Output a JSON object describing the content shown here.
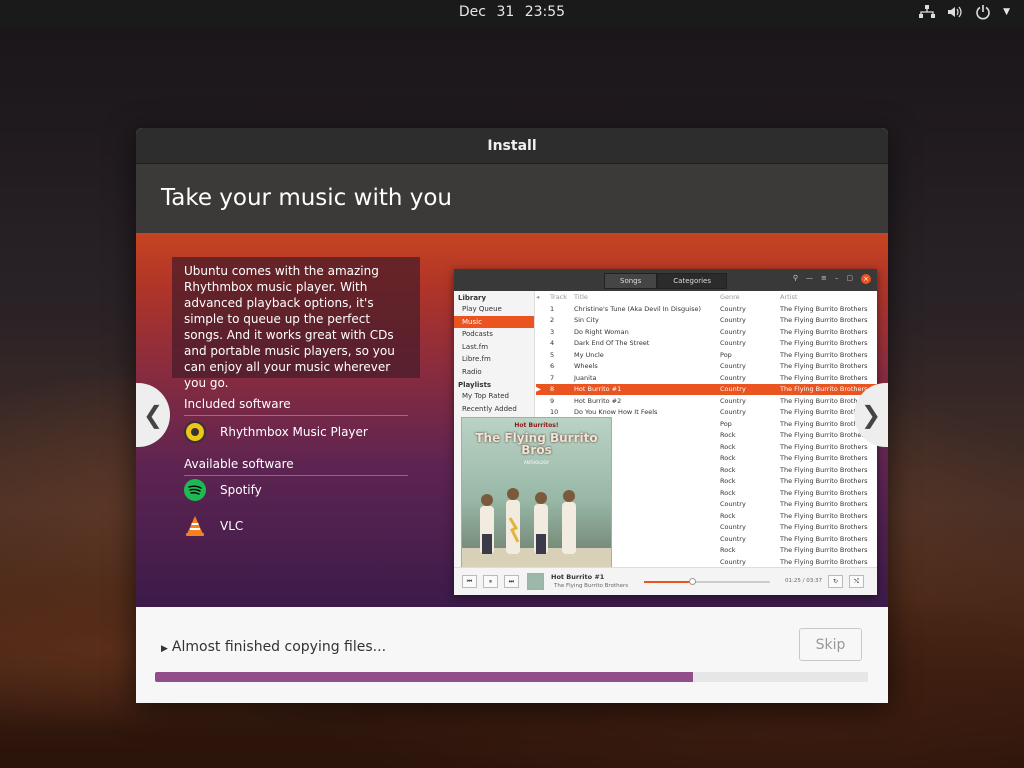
{
  "topbar": {
    "date": "Dec 31",
    "time": "23:55",
    "network_icon": "network-icon",
    "volume_icon": "volume-icon",
    "power_icon": "power-icon",
    "menu_icon": "caret-down-icon"
  },
  "window": {
    "title": "Install"
  },
  "slide": {
    "heading": "Take your music with you",
    "description": "Ubuntu comes with the amazing Rhythmbox music player. With advanced playback options, it's simple to queue up the perfect songs. And it works great with CDs and portable music players, so you can enjoy all your music wherever you go.",
    "included_label": "Included software",
    "included": [
      {
        "name": "Rhythmbox Music Player",
        "icon": "rhythmbox-icon"
      }
    ],
    "available_label": "Available software",
    "available": [
      {
        "name": "Spotify",
        "icon": "spotify-icon",
        "color": "#1db954"
      },
      {
        "name": "VLC",
        "icon": "vlc-icon",
        "color": "#f58220"
      }
    ],
    "prev_arrow": "❮",
    "next_arrow": "❯"
  },
  "rhythmbox": {
    "tabs": [
      "Songs",
      "Categories"
    ],
    "sidebar": {
      "library_label": "Library",
      "library": [
        "Play Queue",
        "Music",
        "Podcasts",
        "Last.fm",
        "Libre.fm",
        "Radio"
      ],
      "playlists_label": "Playlists",
      "playlists": [
        "My Top Rated",
        "Recently Added"
      ]
    },
    "columns": [
      "Track",
      "Title",
      "Genre",
      "Artist"
    ],
    "rows": [
      {
        "track": "1",
        "title": "Christine's Tune (Aka Devil In Disguise)",
        "genre": "Country",
        "artist": "The Flying Burrito Brothers"
      },
      {
        "track": "2",
        "title": "Sin City",
        "genre": "Country",
        "artist": "The Flying Burrito Brothers"
      },
      {
        "track": "3",
        "title": "Do Right Woman",
        "genre": "Country",
        "artist": "The Flying Burrito Brothers"
      },
      {
        "track": "4",
        "title": "Dark End Of The Street",
        "genre": "Country",
        "artist": "The Flying Burrito Brothers"
      },
      {
        "track": "5",
        "title": "My Uncle",
        "genre": "Pop",
        "artist": "The Flying Burrito Brothers"
      },
      {
        "track": "6",
        "title": "Wheels",
        "genre": "Country",
        "artist": "The Flying Burrito Brothers"
      },
      {
        "track": "7",
        "title": "Juanita",
        "genre": "Country",
        "artist": "The Flying Burrito Brothers"
      },
      {
        "track": "8",
        "title": "Hot Burrito #1",
        "genre": "Country",
        "artist": "The Flying Burrito Brothers"
      },
      {
        "track": "9",
        "title": "Hot Burrito #2",
        "genre": "Country",
        "artist": "The Flying Burrito Brothers"
      },
      {
        "track": "10",
        "title": "Do You Know How It Feels",
        "genre": "Country",
        "artist": "The Flying Burrito Brothers"
      },
      {
        "track": "",
        "title": "",
        "genre": "Pop",
        "artist": "The Flying Burrito Brothers"
      },
      {
        "track": "",
        "title": "ong",
        "genre": "Rock",
        "artist": "The Flying Burrito Brothers"
      },
      {
        "track": "",
        "title": "",
        "genre": "Rock",
        "artist": "The Flying Burrito Brothers"
      },
      {
        "track": "",
        "title": "",
        "genre": "Rock",
        "artist": "The Flying Burrito Brothers"
      },
      {
        "track": "",
        "title": "n Queen",
        "genre": "Rock",
        "artist": "The Flying Burrito Brothers"
      },
      {
        "track": "",
        "title": "Go",
        "genre": "Rock",
        "artist": "The Flying Burrito Brothers"
      },
      {
        "track": "",
        "title": "Fog",
        "genre": "Rock",
        "artist": "The Flying Burrito Brothers"
      },
      {
        "track": "",
        "title": "ng",
        "genre": "Country",
        "artist": "The Flying Burrito Brothers"
      },
      {
        "track": "",
        "title": "",
        "genre": "Rock",
        "artist": "The Flying Burrito Brothers"
      },
      {
        "track": "",
        "title": "",
        "genre": "Country",
        "artist": "The Flying Burrito Brothers"
      },
      {
        "track": "",
        "title": "Singer",
        "genre": "Country",
        "artist": "The Flying Burrito Brothers"
      },
      {
        "track": "",
        "title": "Churchyard",
        "genre": "Rock",
        "artist": "The Flying Burrito Brothers"
      },
      {
        "track": "",
        "title": "",
        "genre": "Country",
        "artist": "The Flying Burrito Brothers"
      }
    ],
    "selected_index": 7,
    "album": {
      "title": "Hot Burritos!",
      "band": "The Flying Burrito Bros",
      "subtitle": "ANTHOLOGY"
    },
    "player": {
      "song": "Hot Burrito #1",
      "artist": "The Flying Burrito Brothers",
      "time": "01:25 / 03:37",
      "progress": 0.38
    }
  },
  "footer": {
    "status": "Almost finished copying files...",
    "skip_label": "Skip",
    "progress_percent": 75.5
  }
}
